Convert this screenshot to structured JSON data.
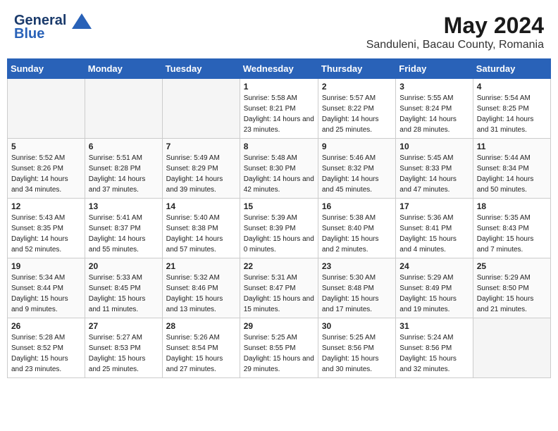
{
  "header": {
    "logo_line1": "General",
    "logo_line2": "Blue",
    "title": "May 2024",
    "subtitle": "Sanduleni, Bacau County, Romania"
  },
  "days_of_week": [
    "Sunday",
    "Monday",
    "Tuesday",
    "Wednesday",
    "Thursday",
    "Friday",
    "Saturday"
  ],
  "weeks": [
    [
      {
        "day": "",
        "sunrise": "",
        "sunset": "",
        "daylight": ""
      },
      {
        "day": "",
        "sunrise": "",
        "sunset": "",
        "daylight": ""
      },
      {
        "day": "",
        "sunrise": "",
        "sunset": "",
        "daylight": ""
      },
      {
        "day": "1",
        "sunrise": "Sunrise: 5:58 AM",
        "sunset": "Sunset: 8:21 PM",
        "daylight": "Daylight: 14 hours and 23 minutes."
      },
      {
        "day": "2",
        "sunrise": "Sunrise: 5:57 AM",
        "sunset": "Sunset: 8:22 PM",
        "daylight": "Daylight: 14 hours and 25 minutes."
      },
      {
        "day": "3",
        "sunrise": "Sunrise: 5:55 AM",
        "sunset": "Sunset: 8:24 PM",
        "daylight": "Daylight: 14 hours and 28 minutes."
      },
      {
        "day": "4",
        "sunrise": "Sunrise: 5:54 AM",
        "sunset": "Sunset: 8:25 PM",
        "daylight": "Daylight: 14 hours and 31 minutes."
      }
    ],
    [
      {
        "day": "5",
        "sunrise": "Sunrise: 5:52 AM",
        "sunset": "Sunset: 8:26 PM",
        "daylight": "Daylight: 14 hours and 34 minutes."
      },
      {
        "day": "6",
        "sunrise": "Sunrise: 5:51 AM",
        "sunset": "Sunset: 8:28 PM",
        "daylight": "Daylight: 14 hours and 37 minutes."
      },
      {
        "day": "7",
        "sunrise": "Sunrise: 5:49 AM",
        "sunset": "Sunset: 8:29 PM",
        "daylight": "Daylight: 14 hours and 39 minutes."
      },
      {
        "day": "8",
        "sunrise": "Sunrise: 5:48 AM",
        "sunset": "Sunset: 8:30 PM",
        "daylight": "Daylight: 14 hours and 42 minutes."
      },
      {
        "day": "9",
        "sunrise": "Sunrise: 5:46 AM",
        "sunset": "Sunset: 8:32 PM",
        "daylight": "Daylight: 14 hours and 45 minutes."
      },
      {
        "day": "10",
        "sunrise": "Sunrise: 5:45 AM",
        "sunset": "Sunset: 8:33 PM",
        "daylight": "Daylight: 14 hours and 47 minutes."
      },
      {
        "day": "11",
        "sunrise": "Sunrise: 5:44 AM",
        "sunset": "Sunset: 8:34 PM",
        "daylight": "Daylight: 14 hours and 50 minutes."
      }
    ],
    [
      {
        "day": "12",
        "sunrise": "Sunrise: 5:43 AM",
        "sunset": "Sunset: 8:35 PM",
        "daylight": "Daylight: 14 hours and 52 minutes."
      },
      {
        "day": "13",
        "sunrise": "Sunrise: 5:41 AM",
        "sunset": "Sunset: 8:37 PM",
        "daylight": "Daylight: 14 hours and 55 minutes."
      },
      {
        "day": "14",
        "sunrise": "Sunrise: 5:40 AM",
        "sunset": "Sunset: 8:38 PM",
        "daylight": "Daylight: 14 hours and 57 minutes."
      },
      {
        "day": "15",
        "sunrise": "Sunrise: 5:39 AM",
        "sunset": "Sunset: 8:39 PM",
        "daylight": "Daylight: 15 hours and 0 minutes."
      },
      {
        "day": "16",
        "sunrise": "Sunrise: 5:38 AM",
        "sunset": "Sunset: 8:40 PM",
        "daylight": "Daylight: 15 hours and 2 minutes."
      },
      {
        "day": "17",
        "sunrise": "Sunrise: 5:36 AM",
        "sunset": "Sunset: 8:41 PM",
        "daylight": "Daylight: 15 hours and 4 minutes."
      },
      {
        "day": "18",
        "sunrise": "Sunrise: 5:35 AM",
        "sunset": "Sunset: 8:43 PM",
        "daylight": "Daylight: 15 hours and 7 minutes."
      }
    ],
    [
      {
        "day": "19",
        "sunrise": "Sunrise: 5:34 AM",
        "sunset": "Sunset: 8:44 PM",
        "daylight": "Daylight: 15 hours and 9 minutes."
      },
      {
        "day": "20",
        "sunrise": "Sunrise: 5:33 AM",
        "sunset": "Sunset: 8:45 PM",
        "daylight": "Daylight: 15 hours and 11 minutes."
      },
      {
        "day": "21",
        "sunrise": "Sunrise: 5:32 AM",
        "sunset": "Sunset: 8:46 PM",
        "daylight": "Daylight: 15 hours and 13 minutes."
      },
      {
        "day": "22",
        "sunrise": "Sunrise: 5:31 AM",
        "sunset": "Sunset: 8:47 PM",
        "daylight": "Daylight: 15 hours and 15 minutes."
      },
      {
        "day": "23",
        "sunrise": "Sunrise: 5:30 AM",
        "sunset": "Sunset: 8:48 PM",
        "daylight": "Daylight: 15 hours and 17 minutes."
      },
      {
        "day": "24",
        "sunrise": "Sunrise: 5:29 AM",
        "sunset": "Sunset: 8:49 PM",
        "daylight": "Daylight: 15 hours and 19 minutes."
      },
      {
        "day": "25",
        "sunrise": "Sunrise: 5:29 AM",
        "sunset": "Sunset: 8:50 PM",
        "daylight": "Daylight: 15 hours and 21 minutes."
      }
    ],
    [
      {
        "day": "26",
        "sunrise": "Sunrise: 5:28 AM",
        "sunset": "Sunset: 8:52 PM",
        "daylight": "Daylight: 15 hours and 23 minutes."
      },
      {
        "day": "27",
        "sunrise": "Sunrise: 5:27 AM",
        "sunset": "Sunset: 8:53 PM",
        "daylight": "Daylight: 15 hours and 25 minutes."
      },
      {
        "day": "28",
        "sunrise": "Sunrise: 5:26 AM",
        "sunset": "Sunset: 8:54 PM",
        "daylight": "Daylight: 15 hours and 27 minutes."
      },
      {
        "day": "29",
        "sunrise": "Sunrise: 5:25 AM",
        "sunset": "Sunset: 8:55 PM",
        "daylight": "Daylight: 15 hours and 29 minutes."
      },
      {
        "day": "30",
        "sunrise": "Sunrise: 5:25 AM",
        "sunset": "Sunset: 8:56 PM",
        "daylight": "Daylight: 15 hours and 30 minutes."
      },
      {
        "day": "31",
        "sunrise": "Sunrise: 5:24 AM",
        "sunset": "Sunset: 8:56 PM",
        "daylight": "Daylight: 15 hours and 32 minutes."
      },
      {
        "day": "",
        "sunrise": "",
        "sunset": "",
        "daylight": ""
      }
    ]
  ]
}
